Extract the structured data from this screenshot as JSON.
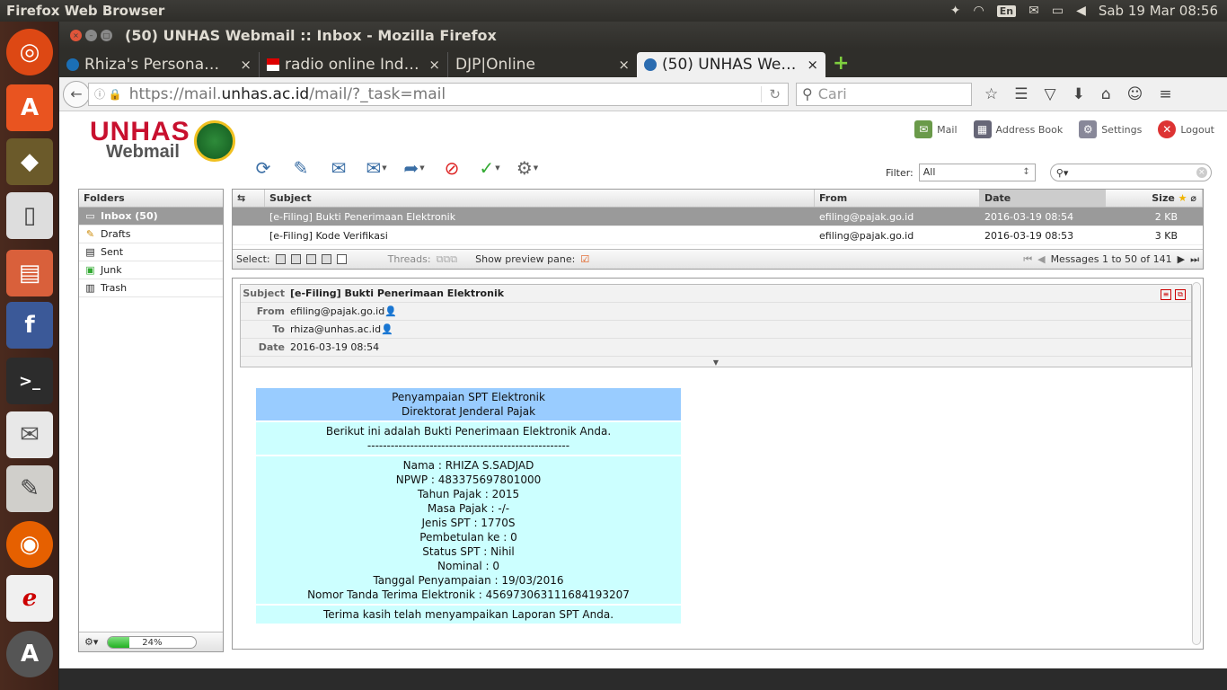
{
  "system": {
    "app_name": "Firefox Web Browser",
    "lang": "En",
    "datetime": "Sab 19 Mar 08:56"
  },
  "window": {
    "title": "(50) UNHAS Webmail :: Inbox - Mozilla Firefox"
  },
  "tabs": [
    {
      "label": "Rhiza's Persona…"
    },
    {
      "label": "radio online Ind…"
    },
    {
      "label": "DJP|Online"
    },
    {
      "label": "(50) UNHAS We…"
    }
  ],
  "nav": {
    "url_prefix": "https://mail.",
    "url_domain": "unhas.ac.id",
    "url_path": "/mail/?_task=mail",
    "search_placeholder": "Cari"
  },
  "logo": {
    "main": "UNHAS",
    "sub": "Webmail"
  },
  "topnav": {
    "mail": "Mail",
    "address_book": "Address Book",
    "settings": "Settings",
    "logout": "Logout"
  },
  "filter": {
    "label": "Filter:",
    "value": "All"
  },
  "folders": {
    "header": "Folders",
    "items": [
      {
        "label": "Inbox (50)"
      },
      {
        "label": "Drafts"
      },
      {
        "label": "Sent"
      },
      {
        "label": "Junk"
      },
      {
        "label": "Trash"
      }
    ],
    "quota": "24%",
    "quota_fraction": 0.24
  },
  "list": {
    "columns": {
      "subject": "Subject",
      "from": "From",
      "date": "Date",
      "size": "Size"
    },
    "rows": [
      {
        "subject": "[e-Filing] Bukti Penerimaan Elektronik",
        "from": "efiling@pajak.go.id",
        "date": "2016-03-19 08:54",
        "size": "2 KB"
      },
      {
        "subject": "[e-Filing] Kode Verifikasi",
        "from": "efiling@pajak.go.id",
        "date": "2016-03-19 08:53",
        "size": "3 KB"
      }
    ],
    "footer": {
      "select": "Select:",
      "threads": "Threads:",
      "preview": "Show preview pane:",
      "messages": "Messages 1 to 50 of 141"
    }
  },
  "message": {
    "labels": {
      "subject": "Subject",
      "from": "From",
      "to": "To",
      "date": "Date"
    },
    "subject": "[e-Filing] Bukti Penerimaan Elektronik",
    "from": "efiling@pajak.go.id",
    "to": "rhiza@unhas.ac.id",
    "date": "2016-03-19 08:54",
    "body": {
      "h1": "Penyampaian SPT Elektronik",
      "h2": "Direktorat Jenderal Pajak",
      "intro": "Berikut ini adalah Bukti Penerimaan Elektronik Anda.",
      "divider": "----------------------------------------------------",
      "lines": [
        "Nama : RHIZA S.SADJAD",
        "NPWP : 483375697801000",
        "Tahun Pajak : 2015",
        "Masa Pajak : -/-",
        "Jenis SPT : 1770S",
        "Pembetulan ke : 0",
        "Status SPT : Nihil",
        "Nominal : 0",
        "Tanggal Penyampaian : 19/03/2016",
        "Nomor Tanda Terima Elektronik : 456973063111684193207"
      ],
      "thanks": "Terima kasih telah menyampaikan Laporan SPT Anda."
    }
  }
}
